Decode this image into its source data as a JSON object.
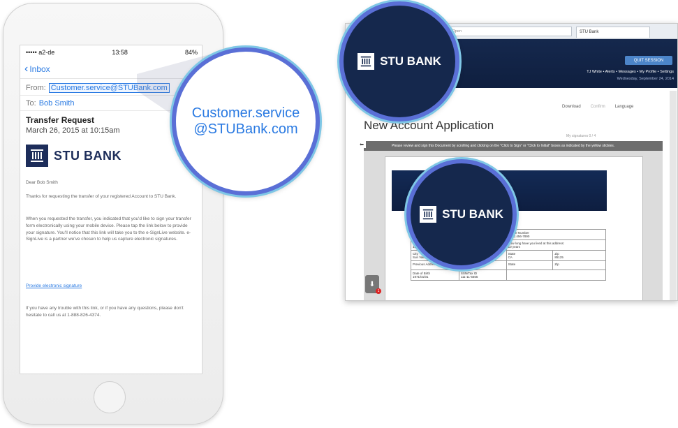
{
  "phone": {
    "status": {
      "carrier": "••••• a2-de",
      "time": "13:58",
      "battery": "84%"
    },
    "nav": {
      "back_label": "Inbox"
    },
    "from_label": "From:",
    "from_value": "Customer.service@STUBank.com",
    "to_label": "To:",
    "to_value": "Bob Smith",
    "subject": "Transfer Request",
    "date": "March 26, 2015 at 10:15am",
    "logo_text": "STU BANK",
    "greeting": "Dear Bob Smith",
    "para1": "Thanks for requesting the transfer of your registered Account to STU Bank.",
    "para2": "When you requested the transfer, you indicated that you'd like to sign your transfer form electronically using your mobile device. Please tap the link below to provide your signature. You'll notice that this link will take you to the e-SignLive website. e-SignLive is a partner we've chosen to help us capture electronic signatures.",
    "link": "Provide electronic signature",
    "para3": "If you have any trouble with this link, or if you have any questions, please don't hesitate to call us at 1-888-826-4374."
  },
  "magnifier_email": {
    "line1": "Customer.service",
    "line2": "@STUBank.com"
  },
  "browser": {
    "url": "/NAFormRequestablePlatform/project/STUFRAME/AccountOpen",
    "tab": "STU Bank",
    "logo_text": "STU BANK",
    "quit_label": "QUIT SESSION",
    "nav": "TJ White • Alerts • Messages • My Profile • Settings",
    "date": "Wednesday, September 24, 2014",
    "tools": {
      "download": "Download",
      "confirm": "Confirm",
      "language": "Language"
    },
    "title": "New Account Application",
    "signatures": "My signatures 0 / 4",
    "instruction": "Please review and sign this Document by scrolling and clicking on the \"Click to Sign\" or \"Click to Initial\" boxes as indicated by the yellow stickies.",
    "form": {
      "phone_label": "Phone Number",
      "phone_value": "(123) 456-7890",
      "no_label": "No.",
      "no_value": "121L",
      "howlong_label": "How long have you lived at this address:",
      "howlong_value": "10 years",
      "city_label": "City",
      "city_value": "Sun Valley",
      "state_label": "State",
      "state_value": "CA",
      "zip_label": "Zip",
      "zip_value": "85125",
      "prev_label": "Previous Address (If less than 5 years)",
      "dob_label": "Date of Birth",
      "dob_value": "1971/01/01",
      "ssn_label": "SSN/Tax ID",
      "ssn_value": "111-11-5555"
    },
    "badge": "1"
  },
  "colors": {
    "brand": "#15284d",
    "link": "#2a7ae2",
    "ring": "#5a6fd6"
  }
}
